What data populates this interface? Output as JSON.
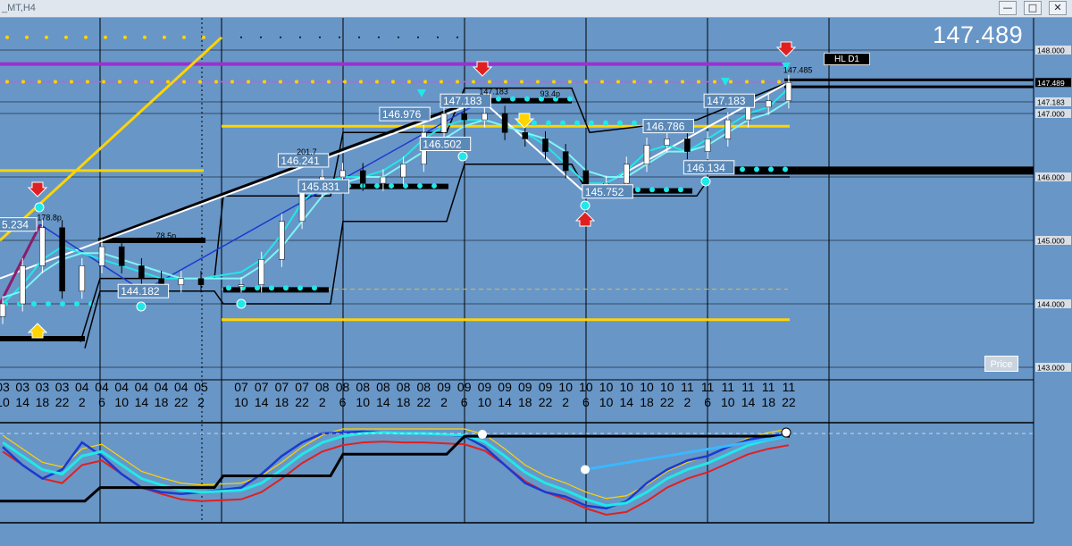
{
  "window": {
    "title": "_MT,H4",
    "buttons": {
      "minimize": "—",
      "maximize": "□",
      "close": "✕"
    }
  },
  "colors": {
    "background": "#6896c7",
    "accent_yellow": "#ffd400",
    "accent_cyan": "#20e8e8",
    "accent_purple": "#9b30d0",
    "sell_red": "#e02020",
    "lines_black": "#000000"
  },
  "current_price": "147.489",
  "hl_label": "HL D1",
  "price_button": "Price",
  "chart_data": {
    "type": "line",
    "price_axis": {
      "ylim": [
        142.8,
        148.8
      ],
      "ticks": [
        {
          "value": 148.0,
          "label": "148.000"
        },
        {
          "value": 147.489,
          "label": "147.489",
          "highlight": true
        },
        {
          "value": 147.183,
          "label": "147.183"
        },
        {
          "value": 147.0,
          "label": "147.000"
        },
        {
          "value": 146.0,
          "label": "146.000"
        },
        {
          "value": 145.0,
          "label": "145.000"
        },
        {
          "value": 144.0,
          "label": "144.000"
        },
        {
          "value": 143.0,
          "label": "143.000"
        }
      ]
    },
    "time_axis": [
      {
        "day": "03",
        "hour": "10"
      },
      {
        "day": "03",
        "hour": "14"
      },
      {
        "day": "03",
        "hour": "18"
      },
      {
        "day": "03",
        "hour": "22"
      },
      {
        "day": "04",
        "hour": "2"
      },
      {
        "day": "04",
        "hour": "6"
      },
      {
        "day": "04",
        "hour": "10"
      },
      {
        "day": "04",
        "hour": "14"
      },
      {
        "day": "04",
        "hour": "18"
      },
      {
        "day": "04",
        "hour": "22"
      },
      {
        "day": "05",
        "hour": "2"
      },
      {
        "day": "07",
        "hour": "10"
      },
      {
        "day": "07",
        "hour": "14"
      },
      {
        "day": "07",
        "hour": "18"
      },
      {
        "day": "07",
        "hour": "22"
      },
      {
        "day": "08",
        "hour": "2"
      },
      {
        "day": "08",
        "hour": "6"
      },
      {
        "day": "08",
        "hour": "10"
      },
      {
        "day": "08",
        "hour": "14"
      },
      {
        "day": "08",
        "hour": "18"
      },
      {
        "day": "08",
        "hour": "22"
      },
      {
        "day": "09",
        "hour": "2"
      },
      {
        "day": "09",
        "hour": "6"
      },
      {
        "day": "09",
        "hour": "10"
      },
      {
        "day": "09",
        "hour": "14"
      },
      {
        "day": "09",
        "hour": "18"
      },
      {
        "day": "09",
        "hour": "22"
      },
      {
        "day": "10",
        "hour": "2"
      },
      {
        "day": "10",
        "hour": "6"
      },
      {
        "day": "10",
        "hour": "10"
      },
      {
        "day": "10",
        "hour": "14"
      },
      {
        "day": "10",
        "hour": "18"
      },
      {
        "day": "10",
        "hour": "22"
      },
      {
        "day": "11",
        "hour": "2"
      },
      {
        "day": "11",
        "hour": "6"
      },
      {
        "day": "11",
        "hour": "10"
      },
      {
        "day": "11",
        "hour": "14"
      },
      {
        "day": "11",
        "hour": "18"
      },
      {
        "day": "11",
        "hour": "22"
      }
    ],
    "price_labels": [
      {
        "text": "5.234",
        "bar": 0,
        "price": 145.23
      },
      {
        "text": "144.182",
        "bar": 6,
        "price": 144.18
      },
      {
        "text": "146.241",
        "bar": 13,
        "price": 146.24
      },
      {
        "text": "145.831",
        "bar": 14,
        "price": 145.83
      },
      {
        "text": "146.976",
        "bar": 18,
        "price": 146.97
      },
      {
        "text": "146.502",
        "bar": 20,
        "price": 146.5
      },
      {
        "text": "147.183",
        "bar": 21,
        "price": 147.18
      },
      {
        "text": "145.752",
        "bar": 28,
        "price": 145.75
      },
      {
        "text": "146.786",
        "bar": 31,
        "price": 146.78
      },
      {
        "text": "146.134",
        "bar": 33,
        "price": 146.13
      },
      {
        "text": "147.183",
        "bar": 34,
        "price": 147.18
      }
    ],
    "small_labels": [
      {
        "text": "178.8p",
        "bar": 2,
        "price": 145.32
      },
      {
        "text": "78.5p",
        "bar": 8,
        "price": 145.03
      },
      {
        "text": "201.7",
        "bar": 14,
        "price": 146.35
      },
      {
        "text": "147.183",
        "bar": 23,
        "price": 147.3
      },
      {
        "text": "93.4p",
        "bar": 26,
        "price": 147.27
      },
      {
        "text": "147.485",
        "bar": 38,
        "price": 147.64
      }
    ],
    "close_prices": [
      144.0,
      144.6,
      145.2,
      144.2,
      144.6,
      144.9,
      144.6,
      144.4,
      144.3,
      144.4,
      144.3,
      144.3,
      144.7,
      145.3,
      145.8,
      146.0,
      146.1,
      145.9,
      146.0,
      146.2,
      146.7,
      147.0,
      146.9,
      147.0,
      146.7,
      146.6,
      146.4,
      146.1,
      145.8,
      145.9,
      146.2,
      146.5,
      146.6,
      146.4,
      146.6,
      146.9,
      147.1,
      147.2,
      147.49
    ],
    "series": [
      {
        "values": [
          144.0,
          144.3,
          144.7,
          144.9,
          144.8,
          144.7,
          144.6,
          144.5,
          144.4,
          144.4,
          144.4,
          144.5,
          144.7,
          145.1,
          145.6,
          145.9,
          146.0,
          146.0,
          146.1,
          146.3,
          146.6,
          146.8,
          146.9,
          146.9,
          146.8,
          146.7,
          146.5,
          146.2,
          145.9,
          145.9,
          146.1,
          146.4,
          146.5,
          146.4,
          146.6,
          146.8,
          147.0,
          147.1,
          147.4
        ]
      },
      {
        "values": [
          144.1,
          144.2,
          144.5,
          144.7,
          144.8,
          144.8,
          144.7,
          144.6,
          144.5,
          144.4,
          144.4,
          144.4,
          144.6,
          144.9,
          145.3,
          145.7,
          145.9,
          146.0,
          146.0,
          146.2,
          146.4,
          146.6,
          146.8,
          146.9,
          146.8,
          146.7,
          146.6,
          146.4,
          146.1,
          146.0,
          146.0,
          146.2,
          146.4,
          146.4,
          146.5,
          146.7,
          146.9,
          147.0,
          147.2
        ]
      }
    ],
    "levels": {
      "purple": 147.78,
      "yellow_dotted_top": 148.2,
      "yellow_dotted": 147.5,
      "yellow_dashed": 144.23
    },
    "oscillator": {
      "ylim": [
        0,
        100
      ],
      "fast": [
        80,
        60,
        45,
        55,
        85,
        70,
        50,
        35,
        30,
        28,
        30,
        35,
        50,
        70,
        85,
        95,
        96,
        97,
        96,
        95,
        95,
        94,
        92,
        80,
        60,
        40,
        30,
        25,
        15,
        12,
        20,
        40,
        55,
        65,
        70,
        80,
        88,
        92,
        95
      ],
      "slow": [
        85,
        70,
        55,
        50,
        70,
        75,
        60,
        45,
        38,
        32,
        30,
        32,
        40,
        55,
        72,
        85,
        92,
        95,
        96,
        95,
        95,
        94,
        93,
        86,
        70,
        52,
        40,
        32,
        22,
        15,
        18,
        30,
        45,
        55,
        62,
        72,
        82,
        88,
        92
      ]
    }
  }
}
